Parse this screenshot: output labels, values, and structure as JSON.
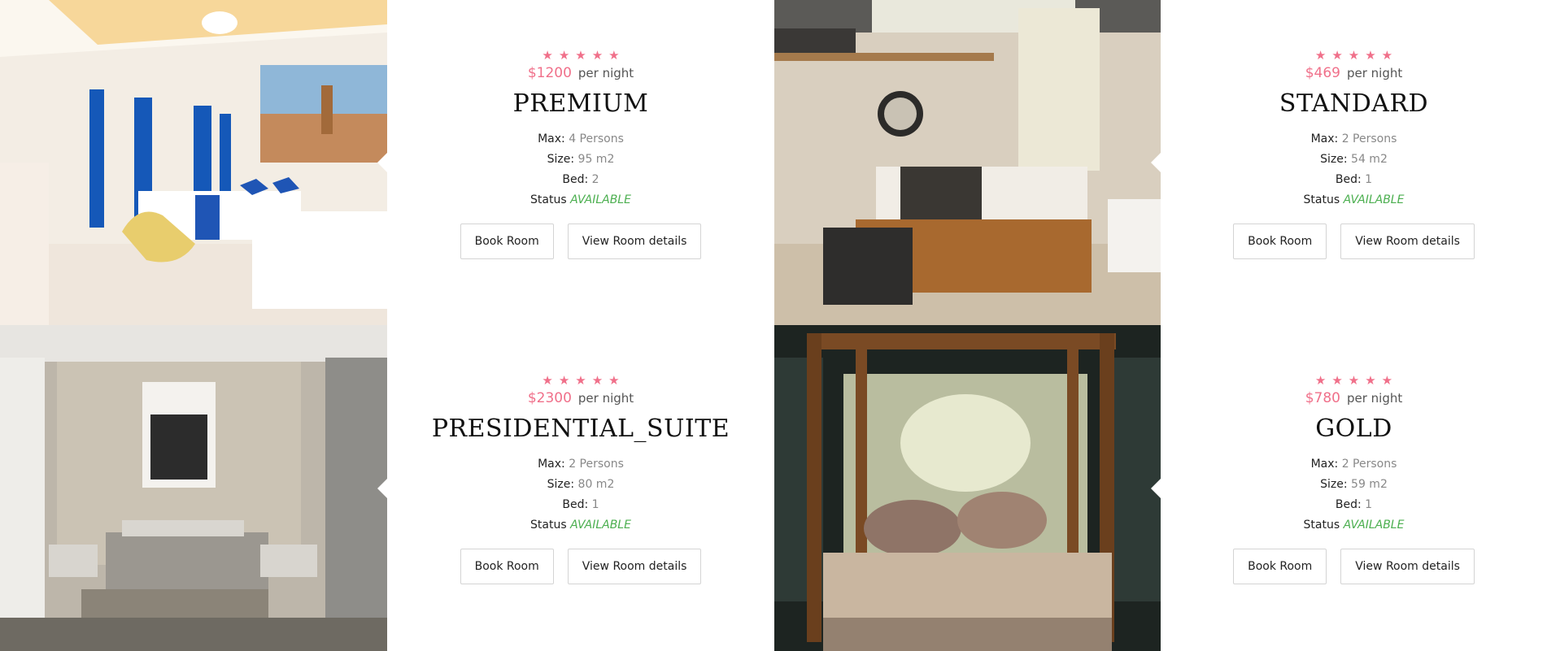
{
  "rooms": [
    {
      "stars": [
        "★",
        "★",
        "★",
        "★",
        "★"
      ],
      "price": "$1200",
      "per_night": "per night",
      "name": "PREMIUM",
      "max_label": "Max:",
      "max_value": "4 Persons",
      "size_label": "Size:",
      "size_value": "95 m2",
      "bed_label": "Bed:",
      "bed_value": "2",
      "status_label": "Status",
      "status_value": "AVAILABLE",
      "book_label": "Book Room",
      "details_label": "View Room details"
    },
    {
      "stars": [
        "★",
        "★",
        "★",
        "★",
        "★"
      ],
      "price": "$469",
      "per_night": "per night",
      "name": "STANDARD",
      "max_label": "Max:",
      "max_value": "2 Persons",
      "size_label": "Size:",
      "size_value": "54 m2",
      "bed_label": "Bed:",
      "bed_value": "1",
      "status_label": "Status",
      "status_value": "AVAILABLE",
      "book_label": "Book Room",
      "details_label": "View Room details"
    },
    {
      "stars": [
        "★",
        "★",
        "★",
        "★",
        "★"
      ],
      "price": "$2300",
      "per_night": "per night",
      "name": "PRESIDENTIAL_SUITE",
      "max_label": "Max:",
      "max_value": "2 Persons",
      "size_label": "Size:",
      "size_value": "80 m2",
      "bed_label": "Bed:",
      "bed_value": "1",
      "status_label": "Status",
      "status_value": "AVAILABLE",
      "book_label": "Book Room",
      "details_label": "View Room details"
    },
    {
      "stars": [
        "★",
        "★",
        "★",
        "★",
        "★"
      ],
      "price": "$780",
      "per_night": "per night",
      "name": "GOLD",
      "max_label": "Max:",
      "max_value": "2 Persons",
      "size_label": "Size:",
      "size_value": "59 m2",
      "bed_label": "Bed:",
      "bed_value": "1",
      "status_label": "Status",
      "status_value": "AVAILABLE",
      "book_label": "Book Room",
      "details_label": "View Room details"
    }
  ],
  "colors": {
    "accent": "#f0708a",
    "available": "#4caf50",
    "muted": "#888888"
  }
}
